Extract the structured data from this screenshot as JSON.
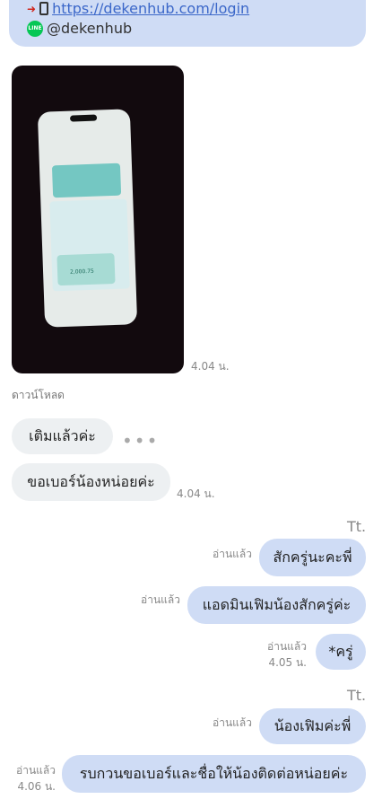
{
  "top_message": {
    "link_text": "https://dekenhub.com/login",
    "line_icon_text": "LINE",
    "line_id": "@dekenhub"
  },
  "photo_message": {
    "time": "4.04 น.",
    "download_label": "ดาวน์โหลด",
    "amount_text": "2,000.75"
  },
  "incoming": [
    {
      "text": "เติมแล้วค่ะ",
      "typing": "•••"
    },
    {
      "text": "ขอเบอร์น้องหน่อยค่ะ",
      "time": "4.04 น."
    }
  ],
  "outgoing_group_1": {
    "sender": "Tt.",
    "messages": [
      {
        "text": "สักครู่นะคะพี่",
        "status": "อ่านแล้ว"
      },
      {
        "text": "แอดมินเฟิมน้องสักครู่ค่ะ",
        "status": "อ่านแล้ว"
      },
      {
        "text": "*ครู่",
        "status": "อ่านแล้ว",
        "time": "4.05 น."
      }
    ]
  },
  "outgoing_group_2": {
    "sender": "Tt.",
    "messages": [
      {
        "text": "น้องเฟิมค่ะพี่",
        "status": "อ่านแล้ว"
      },
      {
        "text": "รบกวนขอเบอร์และชื่อให้น้องติดต่อหน่อยค่ะ",
        "status": "อ่านแล้ว",
        "time": "4.06 น."
      }
    ]
  }
}
